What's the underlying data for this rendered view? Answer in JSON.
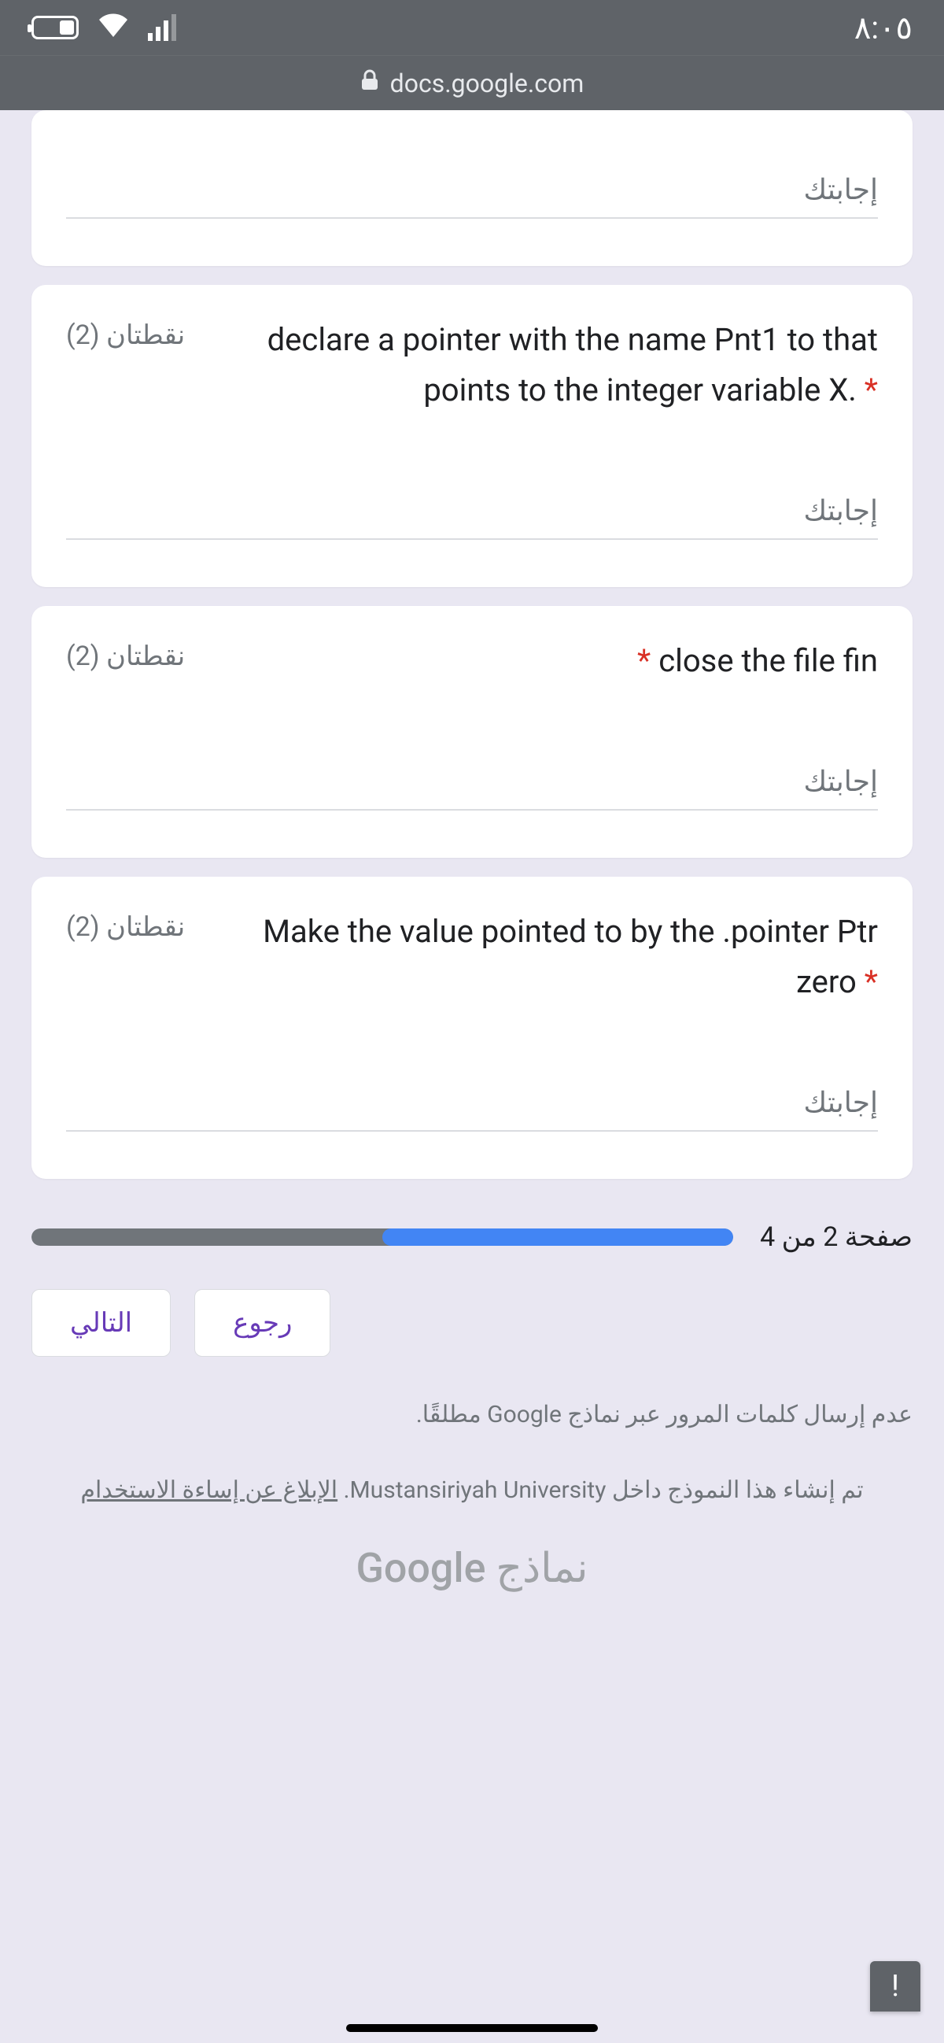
{
  "status": {
    "time": "٨:٠٥"
  },
  "url": "docs.google.com",
  "questions": [
    {
      "points": "",
      "text": "",
      "answer_placeholder": "إجابتك"
    },
    {
      "points": "نقطتان (2)",
      "text": "declare a pointer with the name Pnt1 to that points to the integer variable X.",
      "required": "*",
      "answer_placeholder": "إجابتك"
    },
    {
      "points": "نقطتان (2)",
      "text": "close the file fin",
      "required": "*",
      "answer_placeholder": "إجابتك"
    },
    {
      "points": "نقطتان (2)",
      "text": "Make the value pointed to by the .pointer Ptr zero",
      "required": "*",
      "answer_placeholder": "إجابتك"
    }
  ],
  "progress": {
    "label": "صفحة 2 من 4",
    "percent": 50
  },
  "nav": {
    "next": "التالي",
    "back": "رجوع"
  },
  "disclaimer": "عدم إرسال كلمات المرور عبر نماذج Google مطلقًا.",
  "org": {
    "prefix": "تم إنشاء هذا النموذج داخل ",
    "name": "Mustansiriyah University",
    "sep": ". ",
    "report": "الإبلاغ عن إساءة الاستخدام"
  },
  "brand": {
    "a": "نماذج ",
    "b": "Google"
  },
  "report_icon": "!"
}
